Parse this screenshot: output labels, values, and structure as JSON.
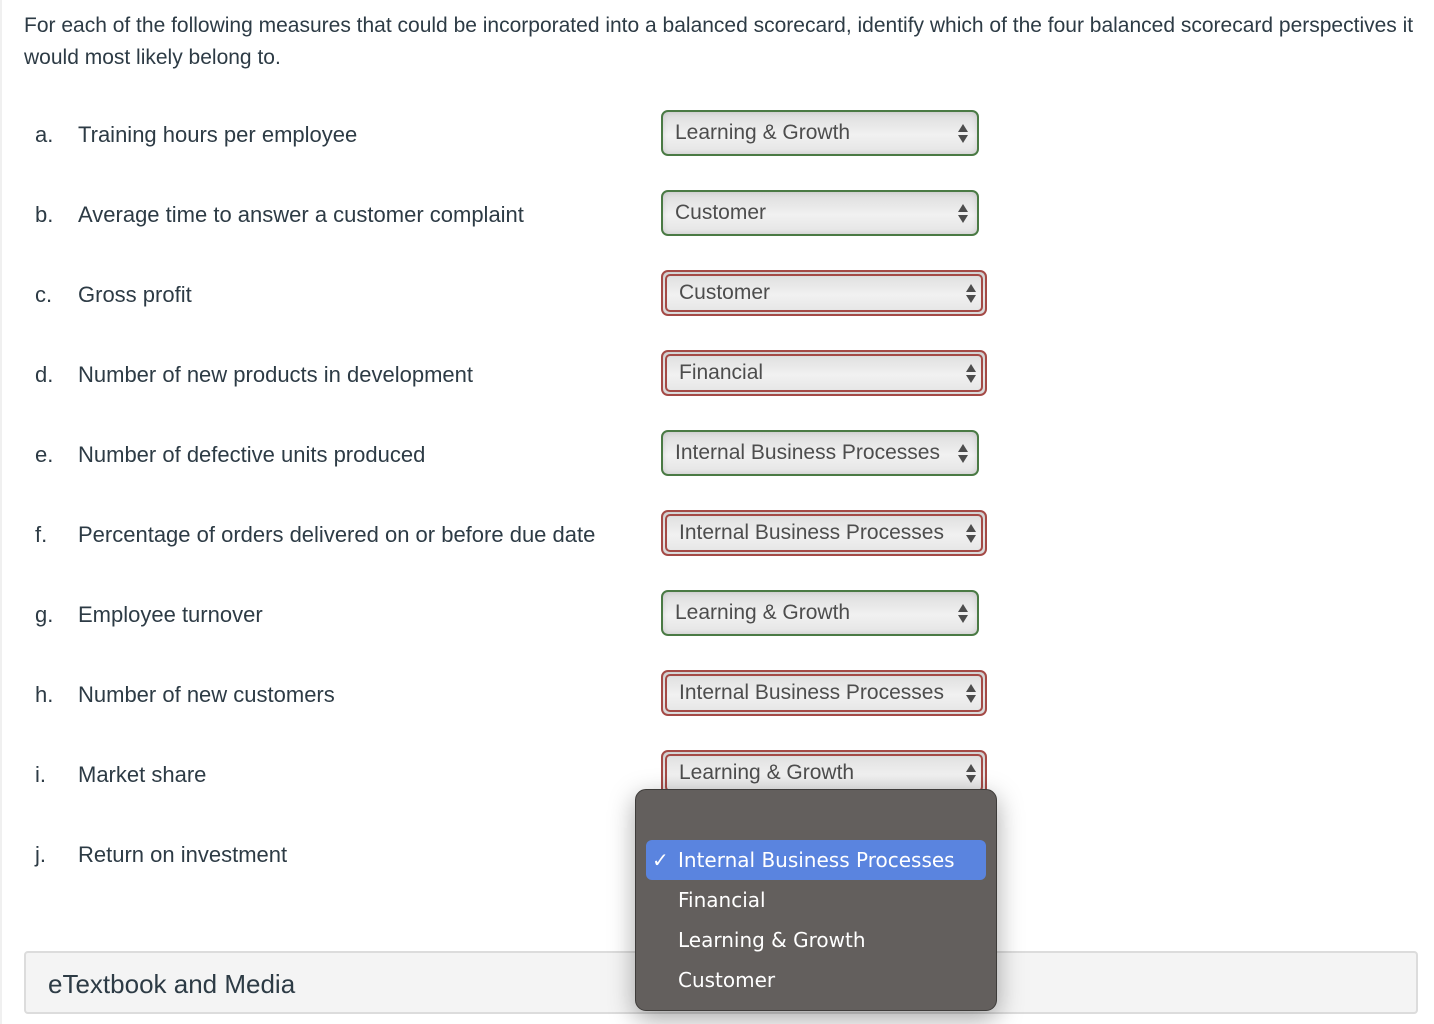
{
  "prompt": "For each of the following measures that could be incorporated into a balanced scorecard, identify which of the four balanced scorecard perspectives it would most likely belong to.",
  "questions": [
    {
      "letter": "a.",
      "text": "Training hours per employee",
      "answer": "Learning & Growth",
      "status": "correct"
    },
    {
      "letter": "b.",
      "text": "Average time to answer a customer complaint",
      "answer": "Customer",
      "status": "correct"
    },
    {
      "letter": "c.",
      "text": "Gross profit",
      "answer": "Customer",
      "status": "incorrect"
    },
    {
      "letter": "d.",
      "text": "Number of new products in development",
      "answer": "Financial",
      "status": "incorrect"
    },
    {
      "letter": "e.",
      "text": "Number of defective units produced",
      "answer": "Internal Business Processes",
      "status": "correct"
    },
    {
      "letter": "f.",
      "text": "Percentage of orders delivered on or before due date",
      "answer": "Internal Business Processes",
      "status": "incorrect"
    },
    {
      "letter": "g.",
      "text": "Employee turnover",
      "answer": "Learning & Growth",
      "status": "correct"
    },
    {
      "letter": "h.",
      "text": "Number of new customers",
      "answer": "Internal Business Processes",
      "status": "incorrect"
    },
    {
      "letter": "i.",
      "text": "Market share",
      "answer": "Learning & Growth",
      "status": "incorrect"
    },
    {
      "letter": "j.",
      "text": "Return on investment",
      "answer": "",
      "status": "open"
    }
  ],
  "dropdown_menu": {
    "options": [
      {
        "label": "Internal Business Processes",
        "selected": true,
        "check": "✓"
      },
      {
        "label": "Financial",
        "selected": false,
        "check": ""
      },
      {
        "label": "Learning & Growth",
        "selected": false,
        "check": ""
      },
      {
        "label": "Customer",
        "selected": false,
        "check": ""
      }
    ]
  },
  "footer": {
    "label": "eTextbook and Media"
  },
  "colors": {
    "correct_border": "#4a7a44",
    "incorrect_border": "#a44a46",
    "menu_bg": "#635f5d",
    "menu_highlight": "#5a84df"
  }
}
